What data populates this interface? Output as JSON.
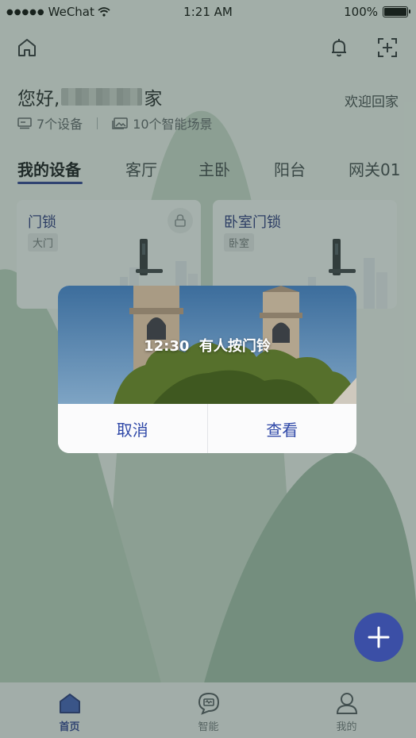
{
  "status_bar": {
    "carrier": "WeChat",
    "time": "1:21 AM",
    "battery_percent": "100%",
    "signal_icon": "signal-dots-icon",
    "wifi_icon": "wifi-icon",
    "battery_icon": "battery-icon"
  },
  "header": {
    "home_icon": "home-icon",
    "bell_icon": "bell-icon",
    "scan_icon": "scan-add-icon"
  },
  "greeting": {
    "prefix": "您好,",
    "suffix": "家",
    "welcome": "欢迎回家"
  },
  "stats": {
    "devices": "7个设备",
    "scenes": "10个智能场景"
  },
  "tabs": [
    {
      "label": "我的设备",
      "active": true
    },
    {
      "label": "客厅"
    },
    {
      "label": "主卧"
    },
    {
      "label": "阳台"
    },
    {
      "label": "网关01"
    }
  ],
  "devices": [
    {
      "name": "门锁",
      "room": "大门",
      "icon": "lock-icon"
    },
    {
      "name": "卧室门锁",
      "room": "卧室"
    }
  ],
  "dialog": {
    "time": "12:30",
    "message": "有人按门铃",
    "cancel_label": "取消",
    "view_label": "查看"
  },
  "fab": {
    "icon": "plus-icon"
  },
  "bottom_nav": [
    {
      "label": "首页",
      "icon": "home-filled-icon",
      "active": true
    },
    {
      "label": "智能",
      "icon": "smart-chat-icon"
    },
    {
      "label": "我的",
      "icon": "profile-icon"
    }
  ],
  "colors": {
    "accent": "#2a3a92",
    "fab": "#3b4fa6",
    "dim_overlay": "#3a5246"
  }
}
